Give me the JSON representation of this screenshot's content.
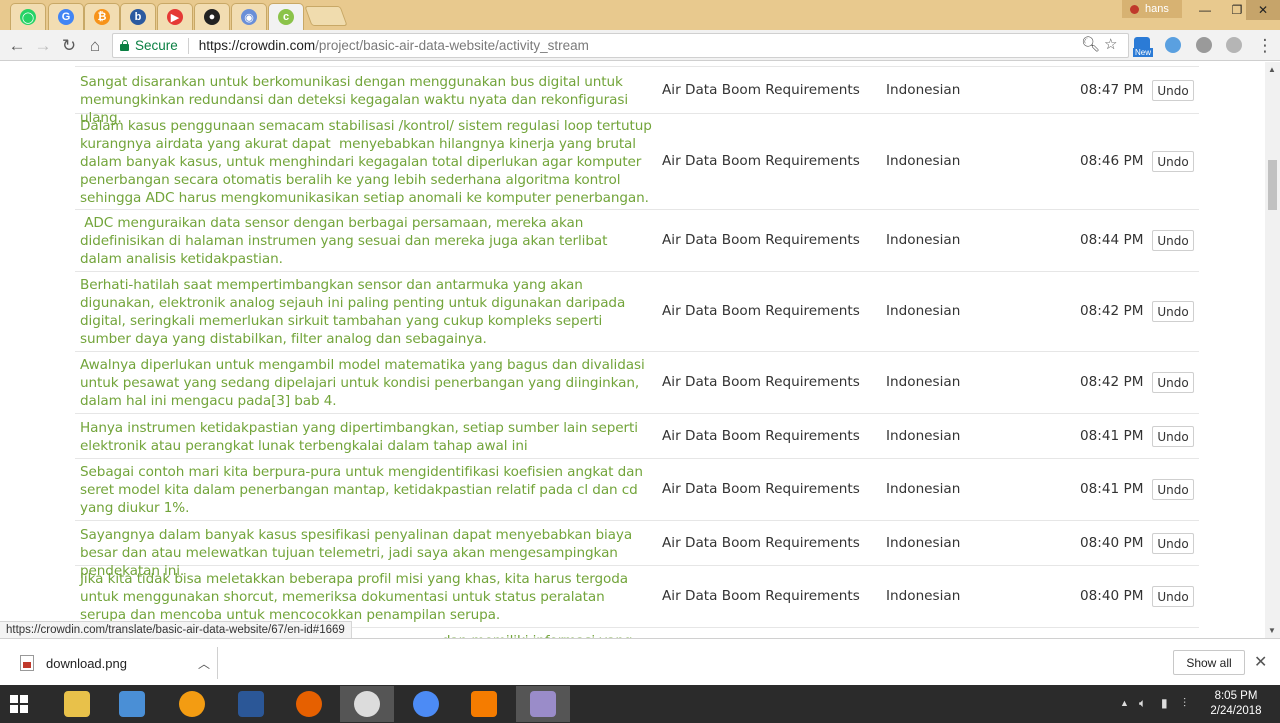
{
  "browser": {
    "tabs": [
      {
        "icon": "whatsapp-icon",
        "color": "#25d366",
        "glyph": "◯"
      },
      {
        "icon": "google-icon",
        "color": "#4285f4",
        "glyph": "G"
      },
      {
        "icon": "bitcoin-icon",
        "color": "#f7931a",
        "glyph": "₿"
      },
      {
        "icon": "bookmark-tab-icon",
        "color": "#2c5aa0",
        "glyph": "b"
      },
      {
        "icon": "youtube-icon",
        "color": "#e53935",
        "glyph": "▶"
      },
      {
        "icon": "github-icon",
        "color": "#222222",
        "glyph": "●"
      },
      {
        "icon": "eye-icon",
        "color": "#6a8fd8",
        "glyph": "◉"
      },
      {
        "icon": "crowdin-icon",
        "color": "#8bc34a",
        "glyph": "c"
      }
    ],
    "user_name": "hans",
    "window_controls": {
      "minimize": "—",
      "maximize": "❐",
      "close": "✕"
    },
    "secure_label": "Secure",
    "url_host": "https://crowdin.com",
    "url_path": "/project/basic-air-data-website/activity_stream",
    "new_badge": "New"
  },
  "activity": {
    "rows": [
      {
        "text": "Sangat disarankan untuk berkomunikasi dengan menggunakan bus digital untuk memungkinkan redundansi dan deteksi kegagalan waktu nyata dan rekonfigurasi ulang.",
        "file": "Air Data Boom Requirements",
        "language": "Indonesian",
        "time": "08:47 PM",
        "action": "Undo"
      },
      {
        "text": "Dalam kasus penggunaan semacam stabilisasi /kontrol/ sistem regulasi loop tertutup kurangnya airdata yang akurat dapat  menyebabkan hilangnya kinerja yang brutal dalam banyak kasus, untuk menghindari kegagalan total diperlukan agar komputer penerbangan secara otomatis beralih ke yang lebih sederhana algoritma kontrol sehingga ADC harus mengkomunikasikan setiap anomali ke komputer penerbangan.",
        "file": "Air Data Boom Requirements",
        "language": "Indonesian",
        "time": "08:46 PM",
        "action": "Undo"
      },
      {
        "text": " ADC menguraikan data sensor dengan berbagai persamaan, mereka akan didefinisikan di halaman instrumen yang sesuai dan mereka juga akan terlibat dalam analisis ketidakpastian.",
        "file": "Air Data Boom Requirements",
        "language": "Indonesian",
        "time": "08:44 PM",
        "action": "Undo"
      },
      {
        "text": "Berhati-hatilah saat mempertimbangkan sensor dan antarmuka yang akan digunakan, elektronik analog sejauh ini paling penting untuk digunakan daripada digital, seringkali memerlukan sirkuit tambahan yang cukup kompleks seperti sumber daya yang distabilkan, filter analog dan sebagainya.",
        "file": "Air Data Boom Requirements",
        "language": "Indonesian",
        "time": "08:42 PM",
        "action": "Undo"
      },
      {
        "text": "Awalnya diperlukan untuk mengambil model matematika yang bagus dan divalidasi untuk pesawat yang sedang dipelajari untuk kondisi penerbangan yang diinginkan, dalam hal ini mengacu pada[3] bab 4.",
        "file": "Air Data Boom Requirements",
        "language": "Indonesian",
        "time": "08:42 PM",
        "action": "Undo"
      },
      {
        "text": "Hanya instrumen ketidakpastian yang dipertimbangkan, setiap sumber lain seperti elektronik atau perangkat lunak terbengkalai dalam tahap awal ini",
        "file": "Air Data Boom Requirements",
        "language": "Indonesian",
        "time": "08:41 PM",
        "action": "Undo"
      },
      {
        "text": "Sebagai contoh mari kita berpura-pura untuk mengidentifikasi koefisien angkat dan seret model kita dalam penerbangan mantap, ketidakpastian relatif pada cl dan cd yang diukur 1%.",
        "file": "Air Data Boom Requirements",
        "language": "Indonesian",
        "time": "08:41 PM",
        "action": "Undo"
      },
      {
        "text": "Sayangnya dalam banyak kasus spesifikasi penyalinan dapat menyebabkan biaya besar dan atau melewatkan tujuan telemetri, jadi saya akan mengesampingkan pendekatan ini.",
        "file": "Air Data Boom Requirements",
        "language": "Indonesian",
        "time": "08:40 PM",
        "action": "Undo"
      },
      {
        "text": "Jika kita tidak bisa meletakkan beberapa profil misi yang khas, kita harus tergoda untuk menggunakan shorcut, memeriksa dokumentasi untuk status peralatan serupa dan mencoba untuk mencocokkan penampilan serupa.",
        "file": "Air Data Boom Requirements",
        "language": "Indonesian",
        "time": "08:40 PM",
        "action": "Undo"
      }
    ],
    "partial_row_text": "... dan memiliki informasi yang"
  },
  "status_url": "https://crowdin.com/translate/basic-air-data-website/67/en-id#1669",
  "downloads": {
    "file_name": "download.png",
    "show_all_label": "Show all"
  },
  "taskbar": {
    "apps": [
      "file-explorer-icon",
      "media-player-icon",
      "orange-app-icon",
      "word-icon",
      "firefox-icon",
      "chrome-icon",
      "chrome-canary-icon",
      "vlc-icon",
      "paint-icon"
    ],
    "time": "8:05 PM",
    "date": "2/24/2018"
  }
}
